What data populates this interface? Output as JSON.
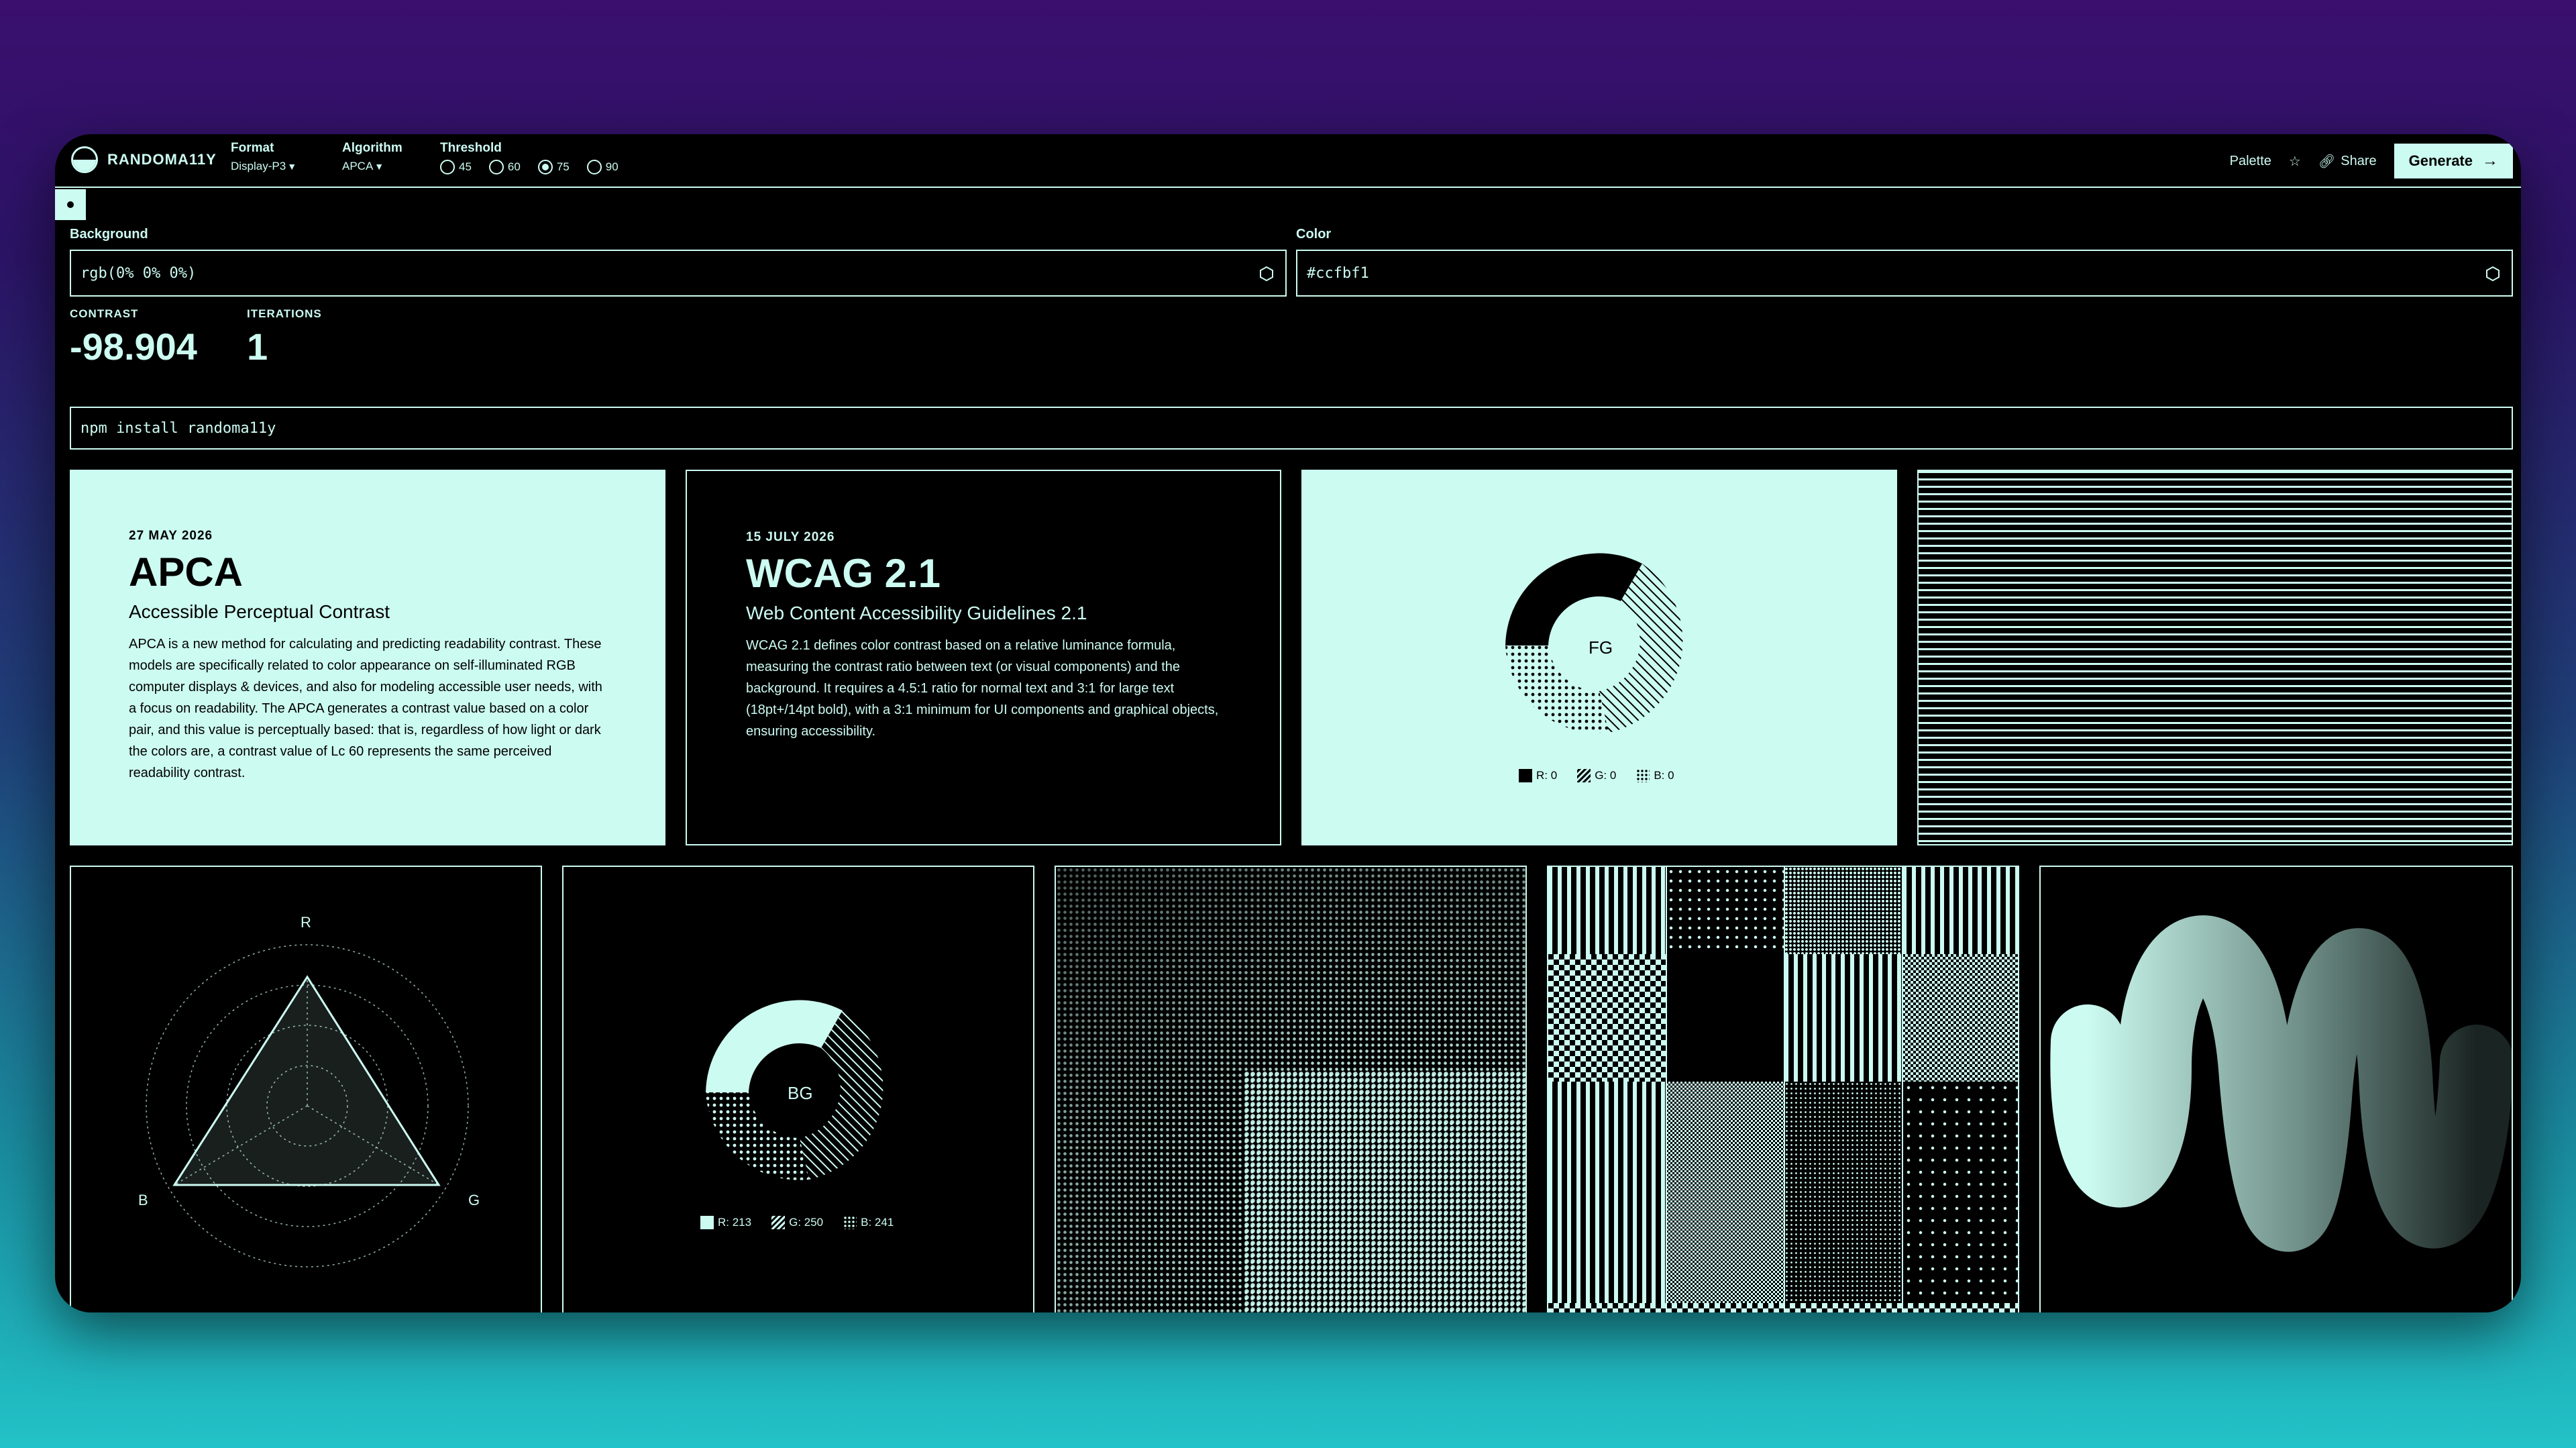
{
  "header": {
    "brand": "RANDOMA11Y",
    "format": {
      "label": "Format",
      "value": "Display-P3"
    },
    "algorithm": {
      "label": "Algorithm",
      "value": "APCA"
    },
    "threshold": {
      "label": "Threshold",
      "options": [
        "45",
        "60",
        "75",
        "90"
      ],
      "selected": "75"
    },
    "palette_label": "Palette",
    "share_label": "Share",
    "generate_label": "Generate"
  },
  "inputs": {
    "background": {
      "label": "Background",
      "value": "rgb(0% 0% 0%)"
    },
    "color": {
      "label": "Color",
      "value": "#ccfbf1"
    }
  },
  "stats": {
    "contrast_label": "CONTRAST",
    "contrast_value": "-98.904",
    "iterations_label": "ITERATIONS",
    "iterations_value": "1"
  },
  "install_cmd": "npm install randoma11y",
  "cards": {
    "apca": {
      "date": "27 MAY 2026",
      "title": "APCA",
      "subtitle": "Accessible Perceptual Contrast",
      "body": "APCA is a new method for calculating and predicting readability contrast. These models are specifically related to color appearance on self-illuminated RGB computer displays & devices, and also for modeling accessible user needs, with a focus on readability. The APCA generates a contrast value based on a color pair, and this value is perceptually based: that is, regardless of how light or dark the colors are, a contrast value of Lc 60 represents the same perceived readability contrast."
    },
    "wcag": {
      "date": "15 JULY 2026",
      "title": "WCAG 2.1",
      "subtitle": "Web Content Accessibility Guidelines 2.1",
      "body": "WCAG 2.1 defines color contrast based on a relative luminance formula, measuring the contrast ratio between text (or visual components) and the background. It requires a 4.5:1 ratio for normal text and 3:1 for large text (18pt+/14pt bold), with a 3:1 minimum for UI components and graphical objects, ensuring accessibility."
    },
    "fg_donut": {
      "center": "FG",
      "legend": [
        "R: 0",
        "G: 0",
        "B: 0"
      ]
    },
    "bg_donut": {
      "center": "BG",
      "legend": [
        "R: 213",
        "G: 250",
        "B: 241"
      ]
    },
    "radar": {
      "labels": [
        "R",
        "B",
        "G"
      ]
    }
  },
  "colors": {
    "bg": "#000000",
    "fg": "#ccfbf1"
  }
}
